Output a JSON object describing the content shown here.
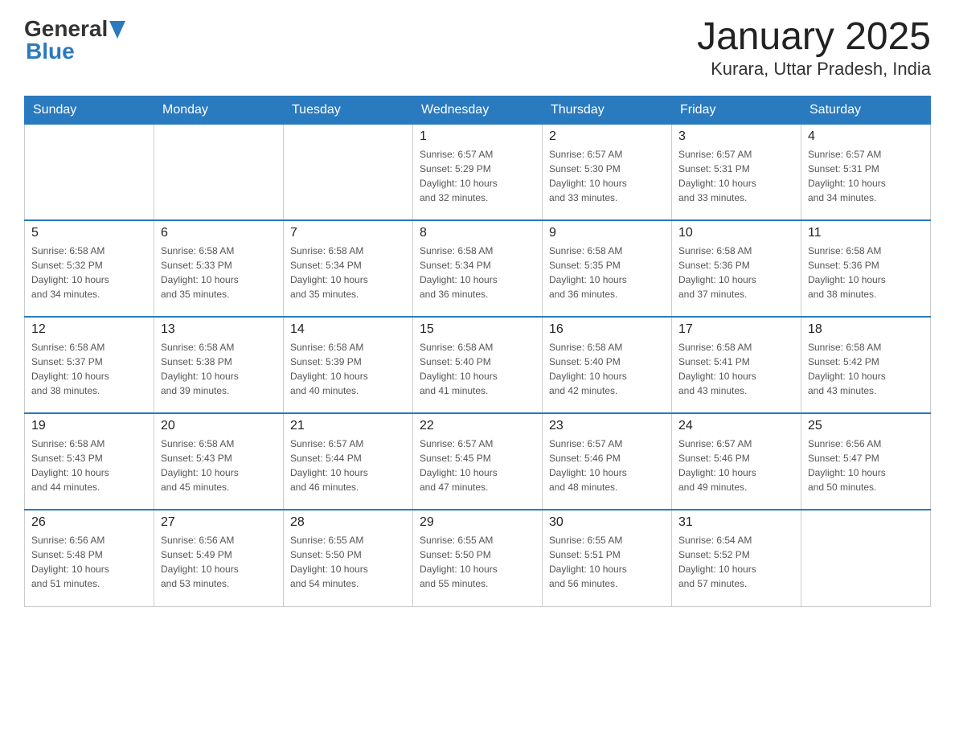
{
  "header": {
    "logo": {
      "general": "General",
      "arrow": "▶",
      "blue": "Blue"
    },
    "title": "January 2025",
    "location": "Kurara, Uttar Pradesh, India"
  },
  "days_of_week": [
    "Sunday",
    "Monday",
    "Tuesday",
    "Wednesday",
    "Thursday",
    "Friday",
    "Saturday"
  ],
  "weeks": [
    [
      {
        "day": "",
        "info": ""
      },
      {
        "day": "",
        "info": ""
      },
      {
        "day": "",
        "info": ""
      },
      {
        "day": "1",
        "info": "Sunrise: 6:57 AM\nSunset: 5:29 PM\nDaylight: 10 hours\nand 32 minutes."
      },
      {
        "day": "2",
        "info": "Sunrise: 6:57 AM\nSunset: 5:30 PM\nDaylight: 10 hours\nand 33 minutes."
      },
      {
        "day": "3",
        "info": "Sunrise: 6:57 AM\nSunset: 5:31 PM\nDaylight: 10 hours\nand 33 minutes."
      },
      {
        "day": "4",
        "info": "Sunrise: 6:57 AM\nSunset: 5:31 PM\nDaylight: 10 hours\nand 34 minutes."
      }
    ],
    [
      {
        "day": "5",
        "info": "Sunrise: 6:58 AM\nSunset: 5:32 PM\nDaylight: 10 hours\nand 34 minutes."
      },
      {
        "day": "6",
        "info": "Sunrise: 6:58 AM\nSunset: 5:33 PM\nDaylight: 10 hours\nand 35 minutes."
      },
      {
        "day": "7",
        "info": "Sunrise: 6:58 AM\nSunset: 5:34 PM\nDaylight: 10 hours\nand 35 minutes."
      },
      {
        "day": "8",
        "info": "Sunrise: 6:58 AM\nSunset: 5:34 PM\nDaylight: 10 hours\nand 36 minutes."
      },
      {
        "day": "9",
        "info": "Sunrise: 6:58 AM\nSunset: 5:35 PM\nDaylight: 10 hours\nand 36 minutes."
      },
      {
        "day": "10",
        "info": "Sunrise: 6:58 AM\nSunset: 5:36 PM\nDaylight: 10 hours\nand 37 minutes."
      },
      {
        "day": "11",
        "info": "Sunrise: 6:58 AM\nSunset: 5:36 PM\nDaylight: 10 hours\nand 38 minutes."
      }
    ],
    [
      {
        "day": "12",
        "info": "Sunrise: 6:58 AM\nSunset: 5:37 PM\nDaylight: 10 hours\nand 38 minutes."
      },
      {
        "day": "13",
        "info": "Sunrise: 6:58 AM\nSunset: 5:38 PM\nDaylight: 10 hours\nand 39 minutes."
      },
      {
        "day": "14",
        "info": "Sunrise: 6:58 AM\nSunset: 5:39 PM\nDaylight: 10 hours\nand 40 minutes."
      },
      {
        "day": "15",
        "info": "Sunrise: 6:58 AM\nSunset: 5:40 PM\nDaylight: 10 hours\nand 41 minutes."
      },
      {
        "day": "16",
        "info": "Sunrise: 6:58 AM\nSunset: 5:40 PM\nDaylight: 10 hours\nand 42 minutes."
      },
      {
        "day": "17",
        "info": "Sunrise: 6:58 AM\nSunset: 5:41 PM\nDaylight: 10 hours\nand 43 minutes."
      },
      {
        "day": "18",
        "info": "Sunrise: 6:58 AM\nSunset: 5:42 PM\nDaylight: 10 hours\nand 43 minutes."
      }
    ],
    [
      {
        "day": "19",
        "info": "Sunrise: 6:58 AM\nSunset: 5:43 PM\nDaylight: 10 hours\nand 44 minutes."
      },
      {
        "day": "20",
        "info": "Sunrise: 6:58 AM\nSunset: 5:43 PM\nDaylight: 10 hours\nand 45 minutes."
      },
      {
        "day": "21",
        "info": "Sunrise: 6:57 AM\nSunset: 5:44 PM\nDaylight: 10 hours\nand 46 minutes."
      },
      {
        "day": "22",
        "info": "Sunrise: 6:57 AM\nSunset: 5:45 PM\nDaylight: 10 hours\nand 47 minutes."
      },
      {
        "day": "23",
        "info": "Sunrise: 6:57 AM\nSunset: 5:46 PM\nDaylight: 10 hours\nand 48 minutes."
      },
      {
        "day": "24",
        "info": "Sunrise: 6:57 AM\nSunset: 5:46 PM\nDaylight: 10 hours\nand 49 minutes."
      },
      {
        "day": "25",
        "info": "Sunrise: 6:56 AM\nSunset: 5:47 PM\nDaylight: 10 hours\nand 50 minutes."
      }
    ],
    [
      {
        "day": "26",
        "info": "Sunrise: 6:56 AM\nSunset: 5:48 PM\nDaylight: 10 hours\nand 51 minutes."
      },
      {
        "day": "27",
        "info": "Sunrise: 6:56 AM\nSunset: 5:49 PM\nDaylight: 10 hours\nand 53 minutes."
      },
      {
        "day": "28",
        "info": "Sunrise: 6:55 AM\nSunset: 5:50 PM\nDaylight: 10 hours\nand 54 minutes."
      },
      {
        "day": "29",
        "info": "Sunrise: 6:55 AM\nSunset: 5:50 PM\nDaylight: 10 hours\nand 55 minutes."
      },
      {
        "day": "30",
        "info": "Sunrise: 6:55 AM\nSunset: 5:51 PM\nDaylight: 10 hours\nand 56 minutes."
      },
      {
        "day": "31",
        "info": "Sunrise: 6:54 AM\nSunset: 5:52 PM\nDaylight: 10 hours\nand 57 minutes."
      },
      {
        "day": "",
        "info": ""
      }
    ]
  ]
}
